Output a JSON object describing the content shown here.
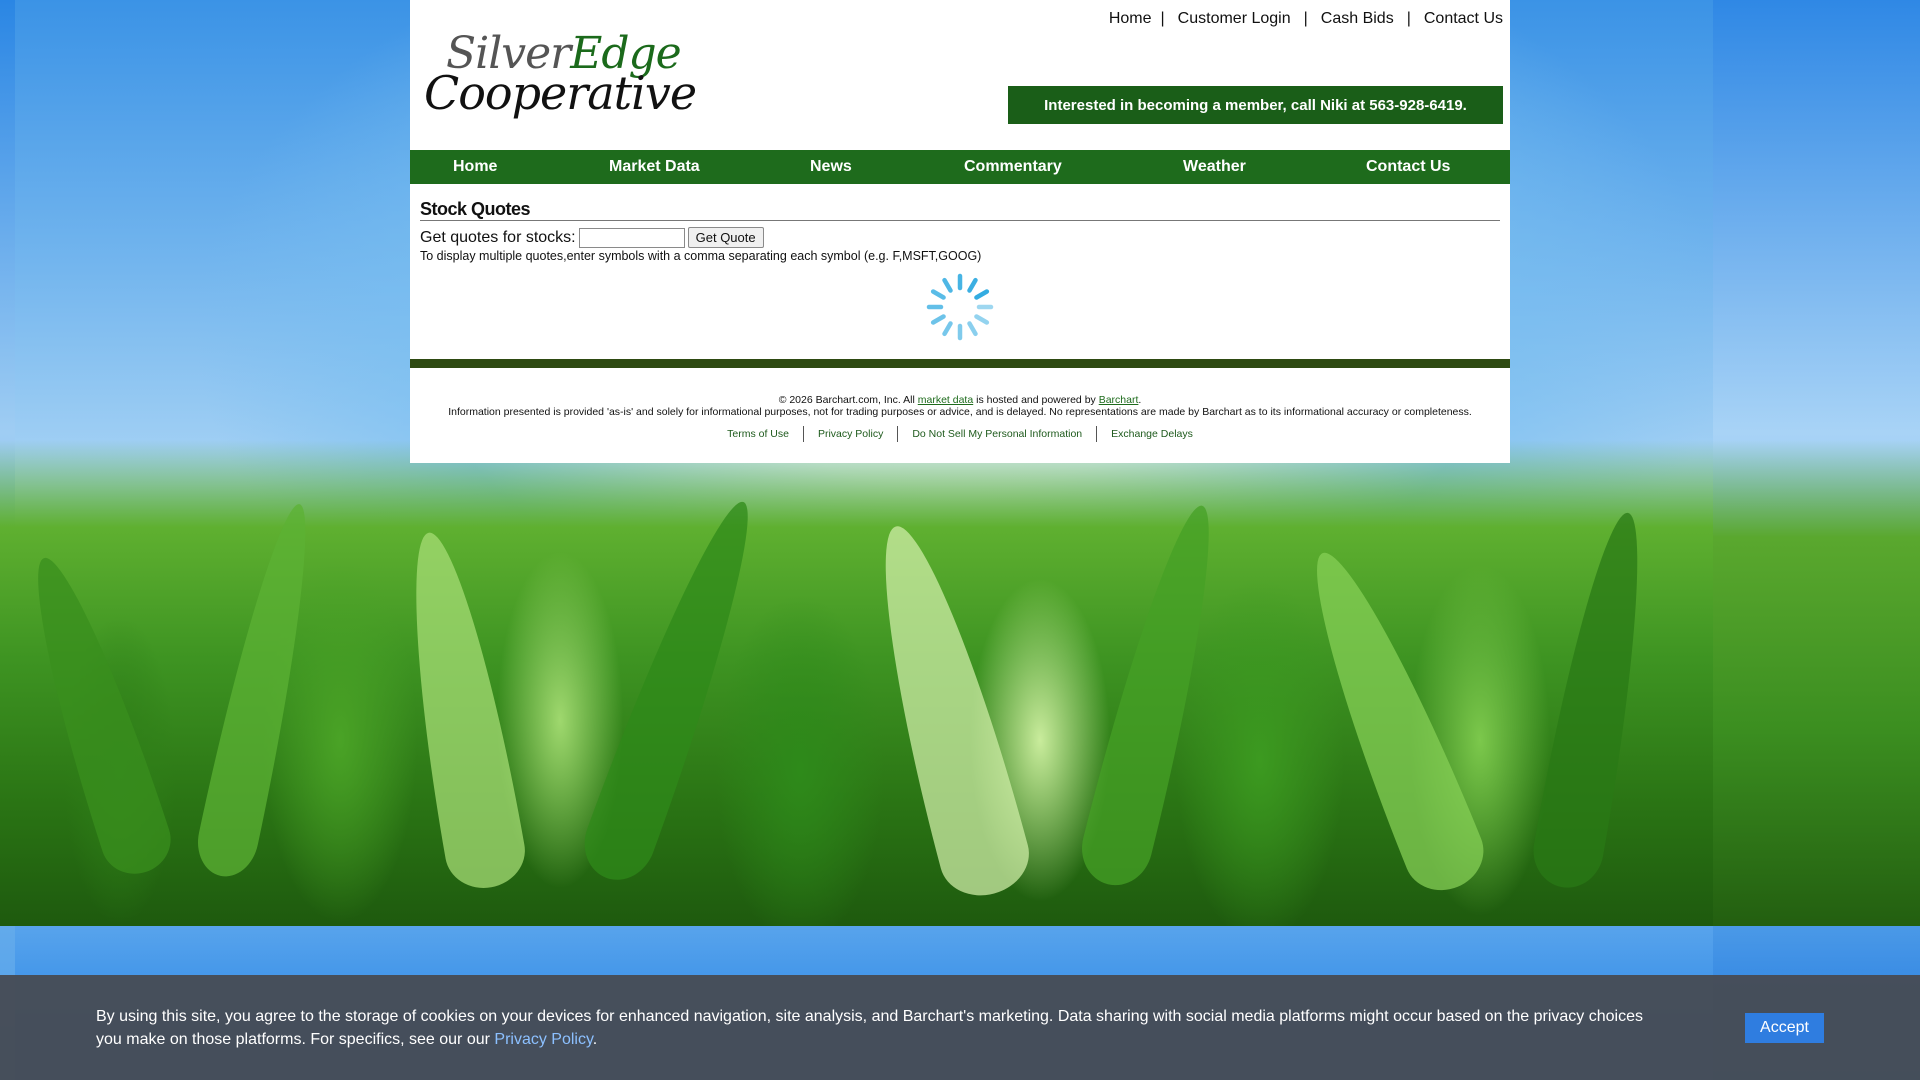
{
  "logo": {
    "part1": "Silver",
    "part2": "Edge",
    "part3": "Cooperative"
  },
  "top_links": [
    "Home",
    "Customer Login",
    "Cash Bids",
    "Contact Us"
  ],
  "top_link_separator": "|",
  "member_banner": "Interested in becoming a member, call Niki at 563-928-6419.",
  "nav": [
    "Home",
    "Market Data",
    "News",
    "Commentary",
    "Weather",
    "Contact Us"
  ],
  "stock_quotes": {
    "title": "Stock Quotes",
    "label": "Get quotes for stocks:",
    "input_value": "",
    "button_label": "Get Quote",
    "hint": "To display multiple quotes,enter symbols with a comma separating each symbol (e.g. F,MSFT,GOOG)"
  },
  "footer": {
    "copyright_prefix": "© 2026 Barchart.com, Inc. All ",
    "market_data_link": "market data",
    "copyright_middle": " is hosted and powered by ",
    "barchart_link": "Barchart",
    "copyright_suffix": ".",
    "disclaimer": "Information presented is provided 'as-is' and solely for informational purposes, not for trading purposes or advice, and is delayed. No representations are made by Barchart as to its informational accuracy or completeness.",
    "links": [
      "Terms of Use",
      "Privacy Policy",
      "Do Not Sell My Personal Information",
      "Exchange Delays"
    ]
  },
  "cookie": {
    "text": "By using this site, you agree to the storage of cookies on your devices for enhanced navigation, site analysis, and Barchart's marketing. Data sharing with social media platforms might occur based on the privacy choices you make on those platforms. For specifics, see our our ",
    "privacy_link": "Privacy Policy",
    "suffix": ".",
    "accept_label": "Accept"
  },
  "colors": {
    "brand_green": "#1e6b1c",
    "banner_green": "#1a5e18",
    "dark_bar": "#2e4a12",
    "spinner_blue": "#29a8e0",
    "accept_blue": "#2f7de0"
  },
  "icons": {
    "loading": "loading-spinner-icon"
  }
}
